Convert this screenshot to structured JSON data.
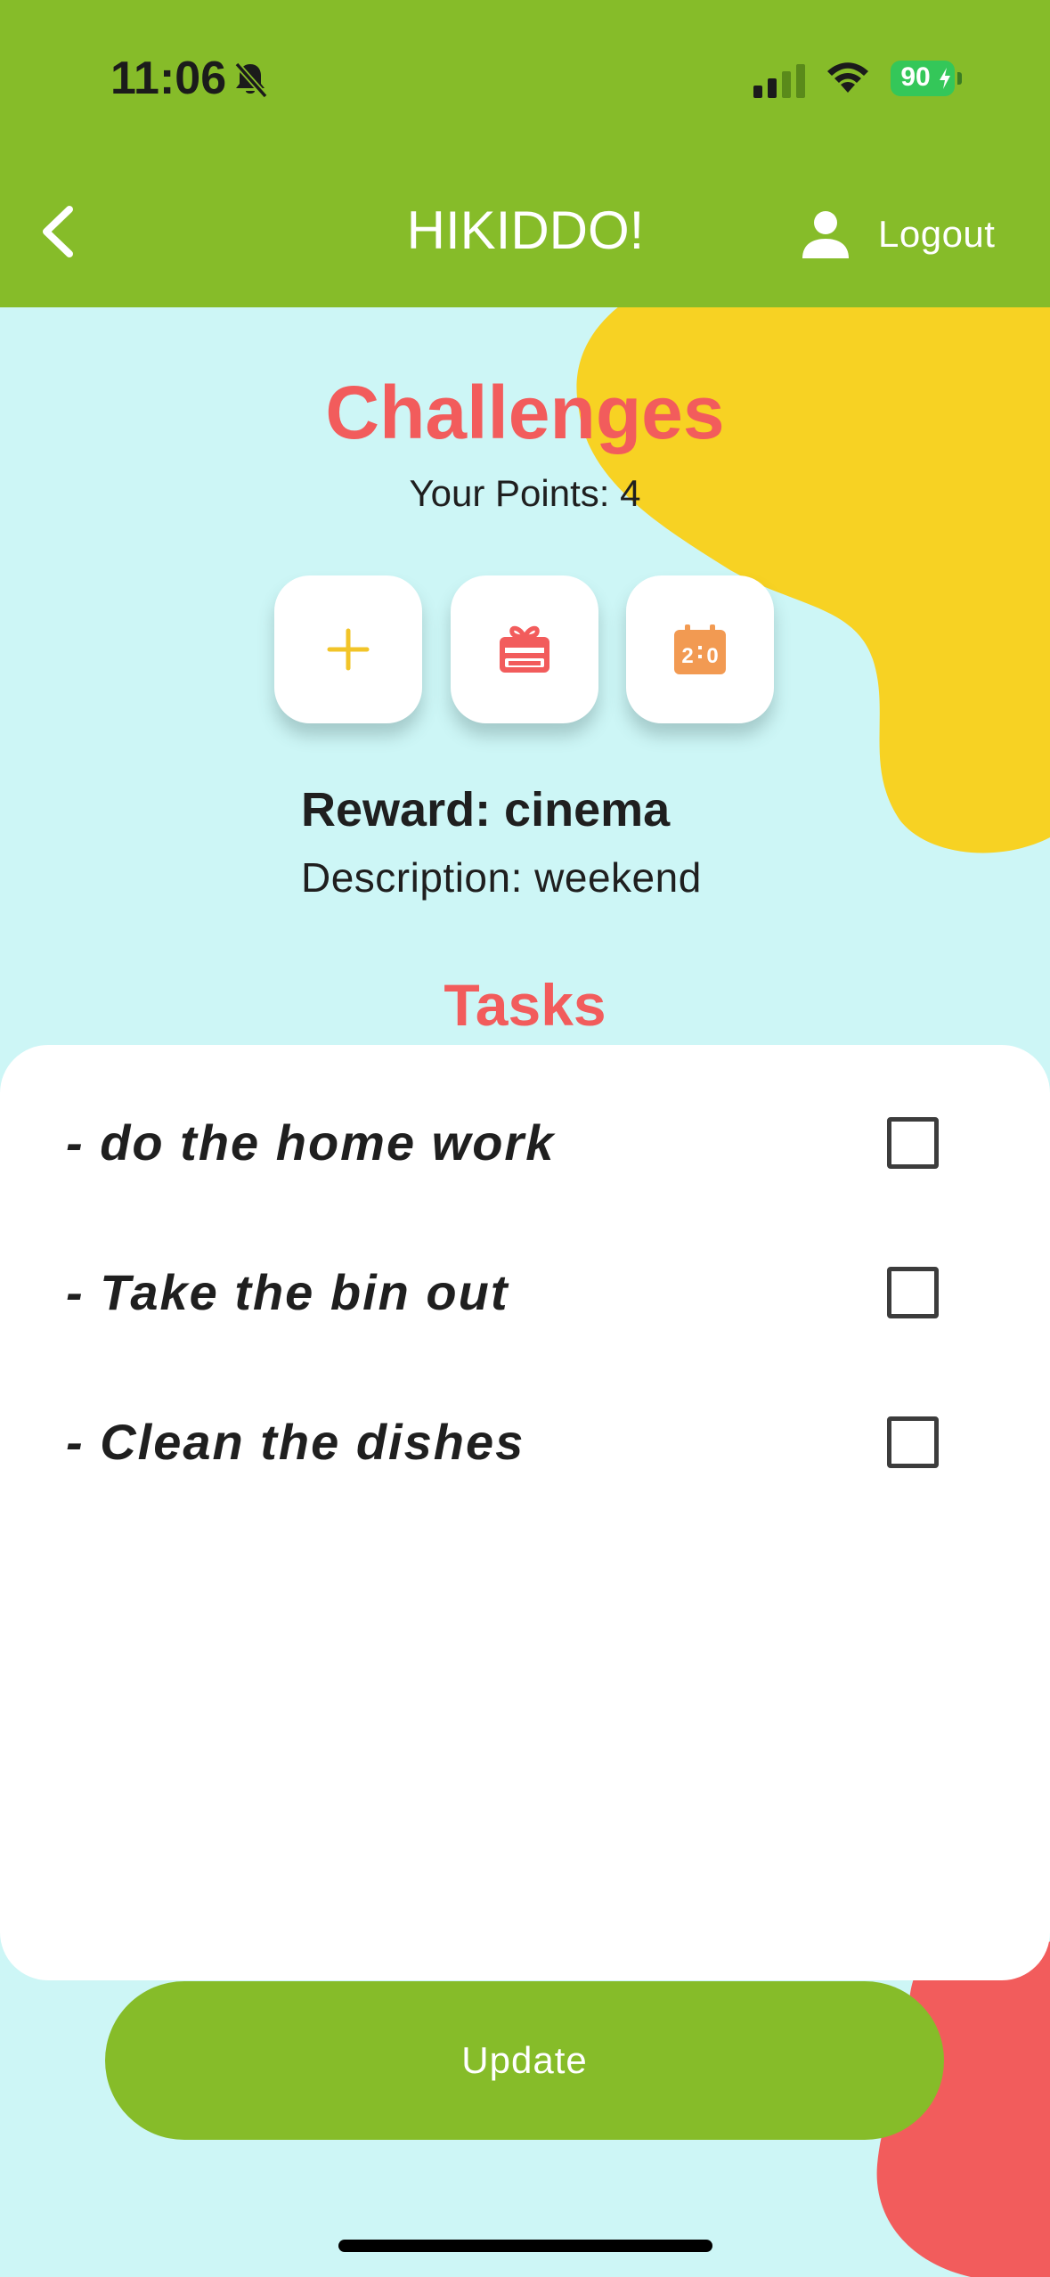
{
  "status_bar": {
    "time": "11:06",
    "battery": "90"
  },
  "nav": {
    "title": "HIKIDDO!",
    "logout_label": "Logout"
  },
  "header": {
    "title": "Challenges",
    "points": "Your Points: 4"
  },
  "actions": [
    {
      "icon": "plus-icon",
      "color": "#f2c428"
    },
    {
      "icon": "gift-icon",
      "color": "#f25c5c"
    },
    {
      "icon": "scoreboard-icon",
      "color": "#f29a52"
    }
  ],
  "reward": {
    "title": "Reward: cinema",
    "description": "Description: weekend"
  },
  "tasks": {
    "heading": "Tasks",
    "items": [
      {
        "label": "- do the home work",
        "checked": false
      },
      {
        "label": "- Take the bin out",
        "checked": false
      },
      {
        "label": "- Clean the dishes",
        "checked": false
      }
    ]
  },
  "footer": {
    "update_label": "Update"
  },
  "colors": {
    "primary_green": "#86bc29",
    "background": "#cdf6f6",
    "accent_red": "#f25c5c",
    "accent_yellow": "#f7d223"
  }
}
